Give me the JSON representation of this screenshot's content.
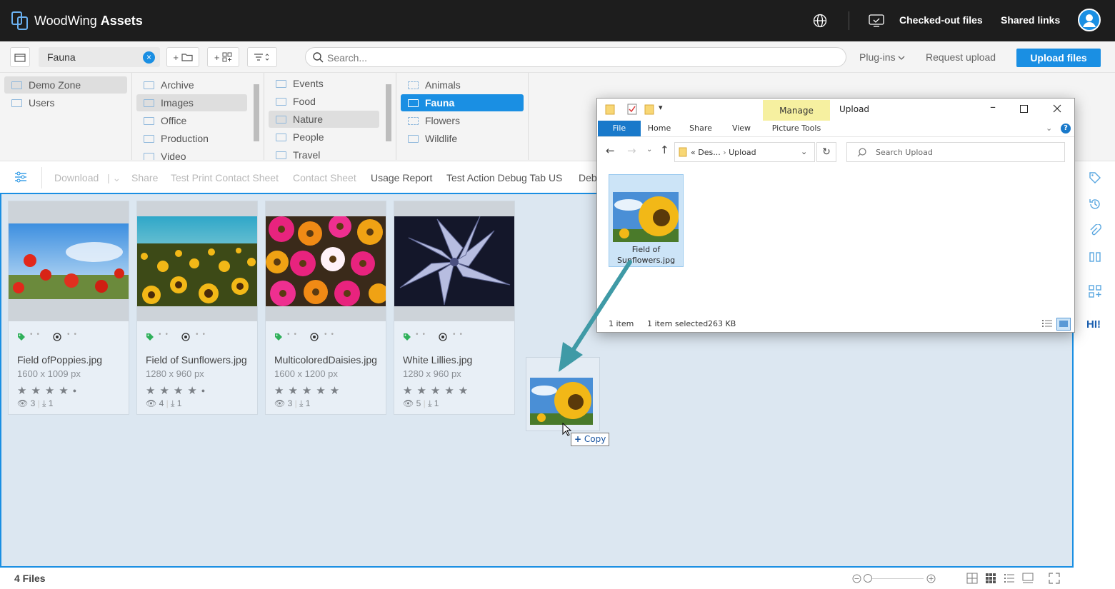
{
  "app": {
    "brand_a": "WoodWing",
    "brand_b": "Assets",
    "checked_out": "Checked-out files",
    "shared_links": "Shared links"
  },
  "toolbar": {
    "breadcrumb": "Fauna",
    "add_folder": "+",
    "add_collection": "+",
    "search_placeholder": "Search...",
    "plugins": "Plug-ins",
    "request_upload": "Request upload",
    "upload_files": "Upload files"
  },
  "folders": {
    "col1": [
      "Demo Zone",
      "Users"
    ],
    "col2": [
      "Archive",
      "Images",
      "Office",
      "Production",
      "Video"
    ],
    "col3": [
      "Events",
      "Food",
      "Nature",
      "People",
      "Travel"
    ],
    "col4": [
      "Animals",
      "Fauna",
      "Flowers",
      "Wildlife"
    ]
  },
  "actions": [
    "Download",
    "Share",
    "Test Print Contact Sheet",
    "Contact Sheet",
    "Usage Report",
    "Test Action Debug Tab US",
    "Deb"
  ],
  "files": [
    {
      "name": "Field ofPoppies.jpg",
      "dims": "1600 x 1009 px",
      "views": "3",
      "downloads": "1",
      "rating": 4
    },
    {
      "name": "Field of Sunflowers.jpg",
      "dims": "1280 x 960 px",
      "views": "4",
      "downloads": "1",
      "rating": 4
    },
    {
      "name": "MulticoloredDaisies.jpg",
      "dims": "1600 x 1200 px",
      "views": "3",
      "downloads": "1",
      "rating": 5
    },
    {
      "name": "White Lillies.jpg",
      "dims": "1280 x 960 px",
      "views": "5",
      "downloads": "1",
      "rating": 5
    }
  ],
  "status": {
    "count": "4 Files"
  },
  "sidebar": {
    "hi": "HI!"
  },
  "explorer": {
    "manage": "Manage",
    "title": "Upload",
    "tabs": [
      "File",
      "Home",
      "Share",
      "View",
      "Picture Tools"
    ],
    "addr_prefix": "«",
    "addr_1": "Des...",
    "addr_sep": "›",
    "addr_2": "Upload",
    "search_placeholder": "Search Upload",
    "file_line1": "Field of",
    "file_line2": "Sunflowers.jpg",
    "status_items": "1 item",
    "status_sel": "1 item selected",
    "status_size": "263 KB"
  },
  "drag": {
    "copy": "Copy"
  }
}
